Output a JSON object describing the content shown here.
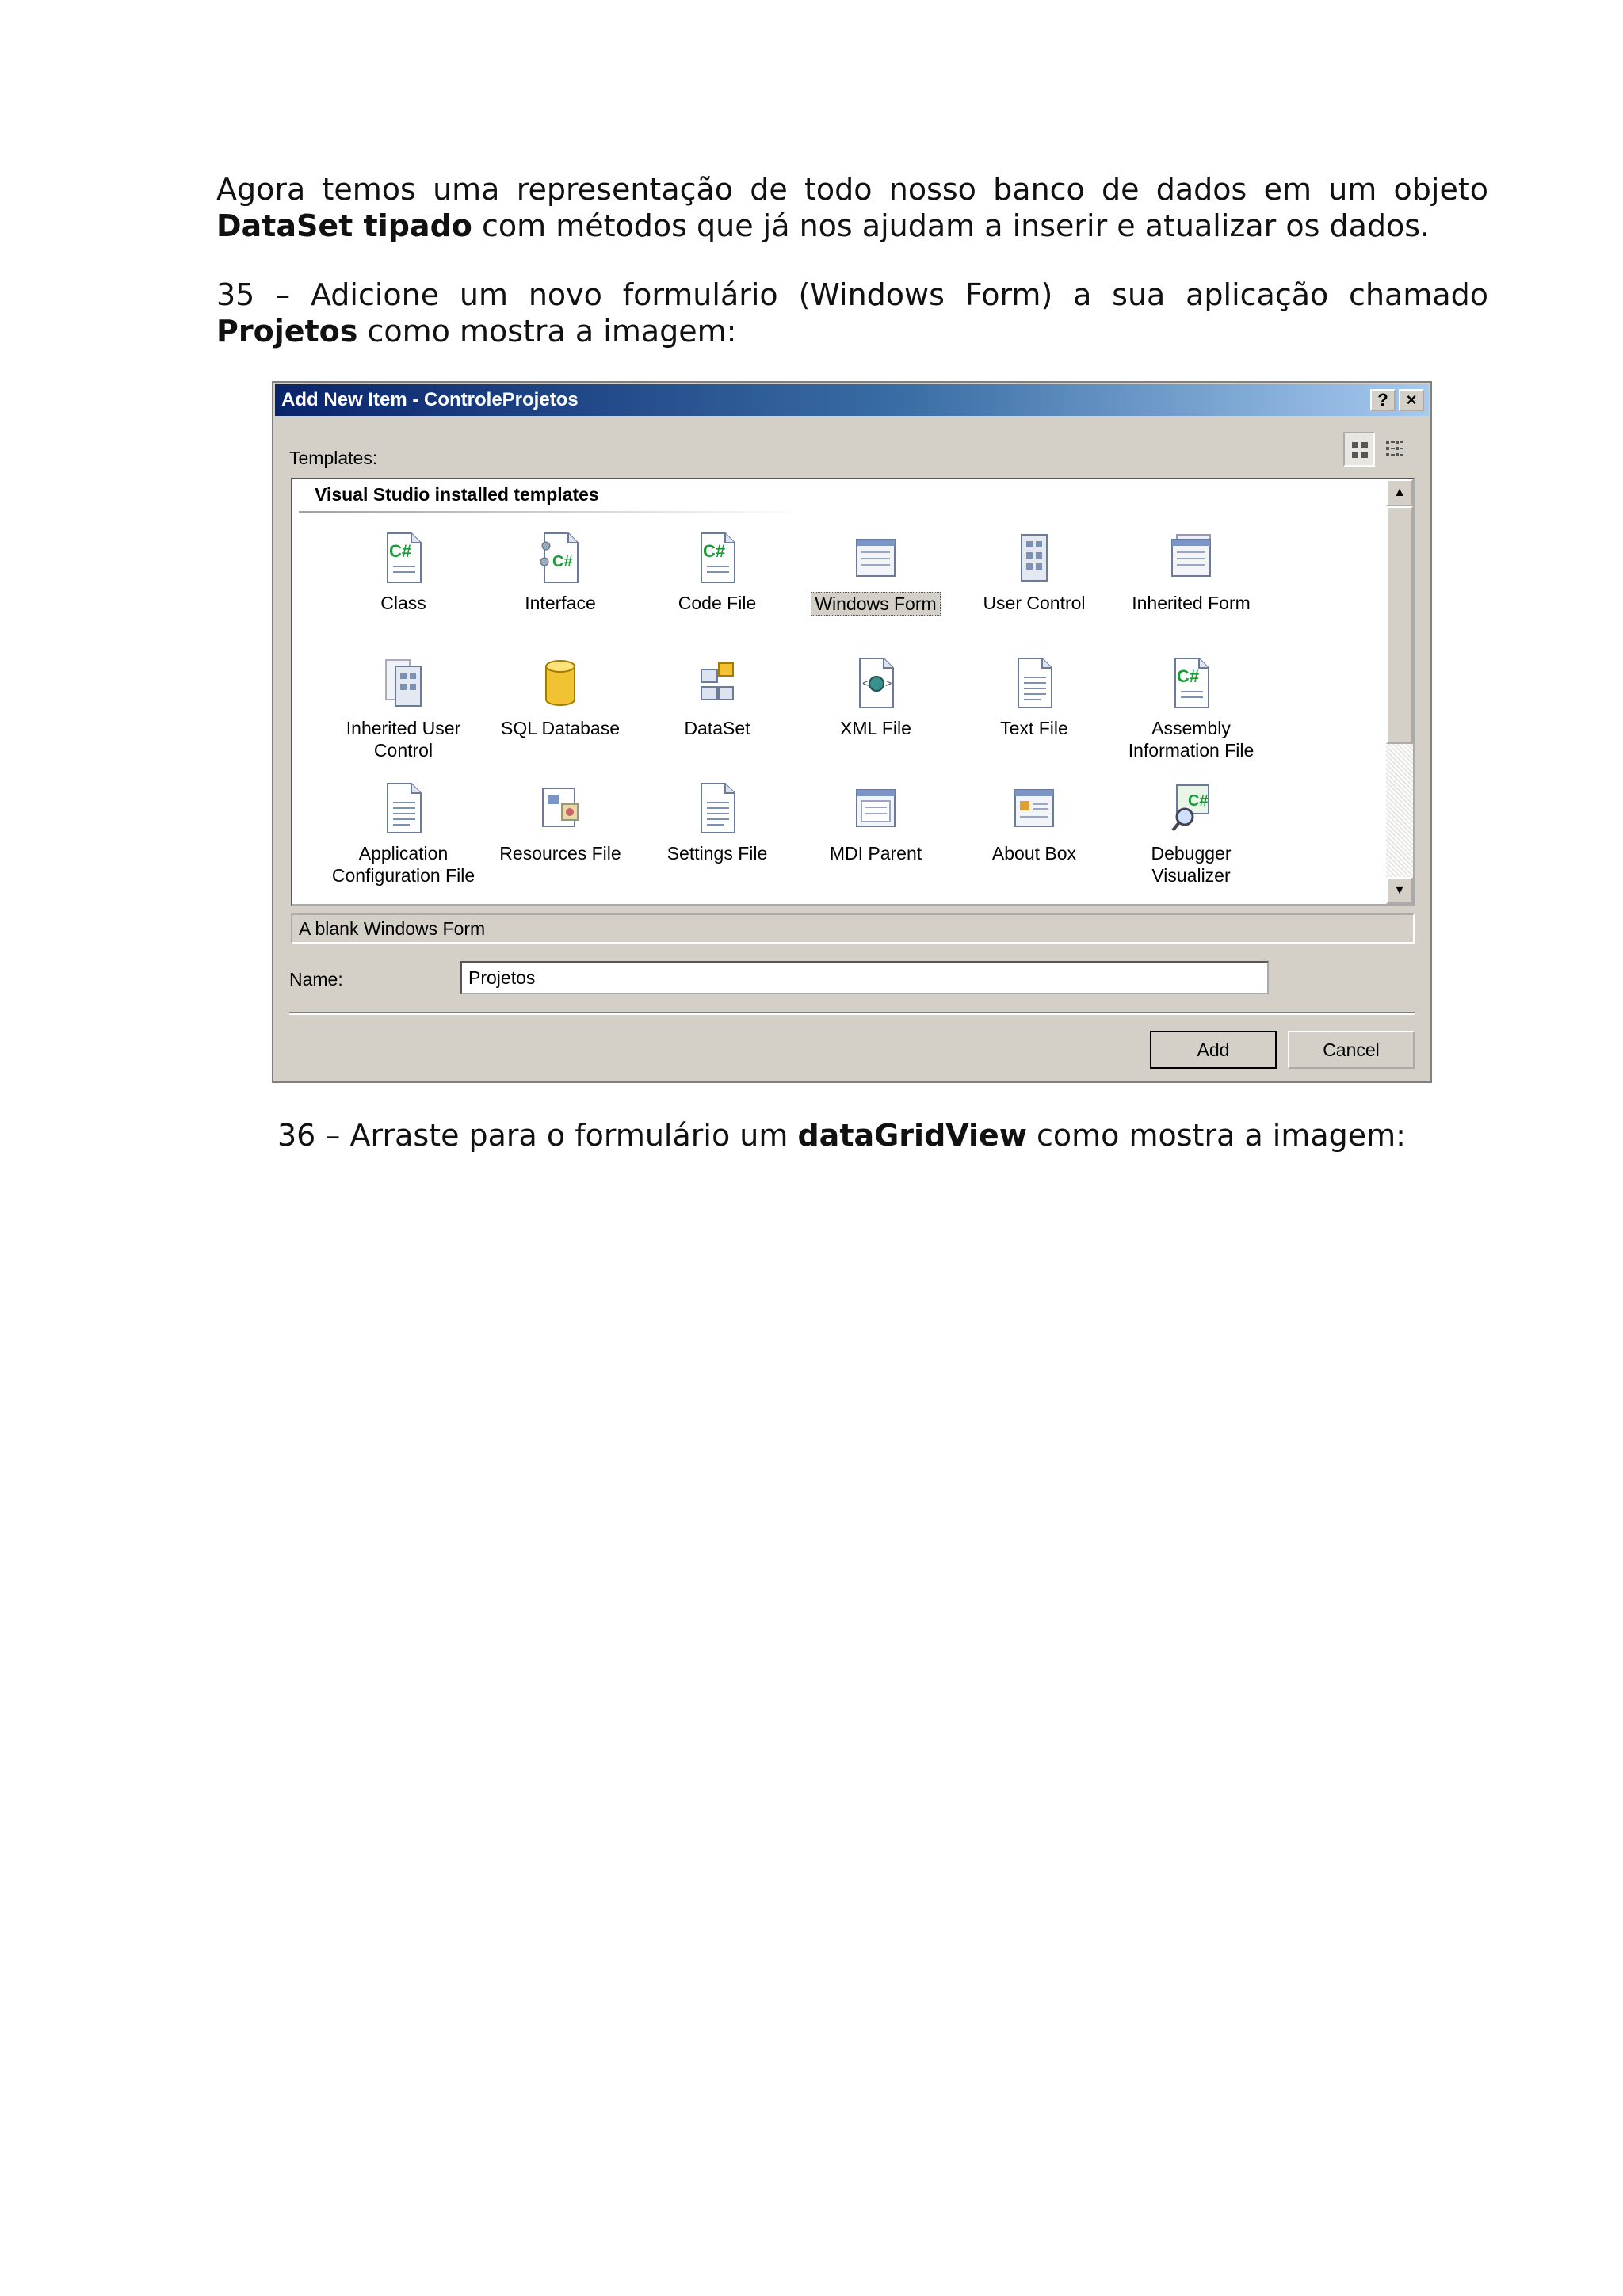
{
  "text": {
    "p1_prefix": "Agora temos uma representação de todo nosso banco de dados em um objeto ",
    "p1_bold": "DataSet tipado",
    "p1_suffix": " com métodos que já nos ajudam a inserir e atualizar os dados.",
    "p2_prefix": "35 – Adicione um novo formulário (Windows Form) a sua aplicação chamado ",
    "p2_bold": "Projetos",
    "p2_suffix": " como mostra a imagem:",
    "p3_prefix": "36 – Arraste para o formulário um ",
    "p3_bold": "dataGridView",
    "p3_suffix": " como mostra a imagem:"
  },
  "dialog": {
    "title": "Add New Item - ControleProjetos",
    "help_label": "?",
    "close_label": "×",
    "templates_label": "Templates:",
    "section_title": "Visual Studio installed templates",
    "templates": [
      {
        "label": "Class",
        "icon": "csharp-file-icon"
      },
      {
        "label": "Interface",
        "icon": "interface-icon"
      },
      {
        "label": "Code File",
        "icon": "csharp-file-icon"
      },
      {
        "label": "Windows Form",
        "icon": "windows-form-icon",
        "selected": true
      },
      {
        "label": "User Control",
        "icon": "user-control-icon"
      },
      {
        "label": "Inherited Form",
        "icon": "inherited-form-icon"
      },
      {
        "label": "Inherited User Control",
        "icon": "inherited-user-control-icon"
      },
      {
        "label": "SQL Database",
        "icon": "database-icon"
      },
      {
        "label": "DataSet",
        "icon": "dataset-icon"
      },
      {
        "label": "XML File",
        "icon": "xml-file-icon"
      },
      {
        "label": "Text File",
        "icon": "text-file-icon"
      },
      {
        "label": "Assembly Information File",
        "icon": "csharp-file-icon"
      },
      {
        "label": "Application Configuration File",
        "icon": "config-file-icon"
      },
      {
        "label": "Resources File",
        "icon": "resources-file-icon"
      },
      {
        "label": "Settings File",
        "icon": "settings-file-icon"
      },
      {
        "label": "MDI Parent",
        "icon": "mdi-parent-icon"
      },
      {
        "label": "About Box",
        "icon": "about-box-icon"
      },
      {
        "label": "Debugger Visualizer",
        "icon": "debugger-visualizer-icon"
      }
    ],
    "description": "A blank Windows Form",
    "name_label": "Name:",
    "name_value": "Projetos",
    "add_label": "Add",
    "cancel_label": "Cancel"
  }
}
